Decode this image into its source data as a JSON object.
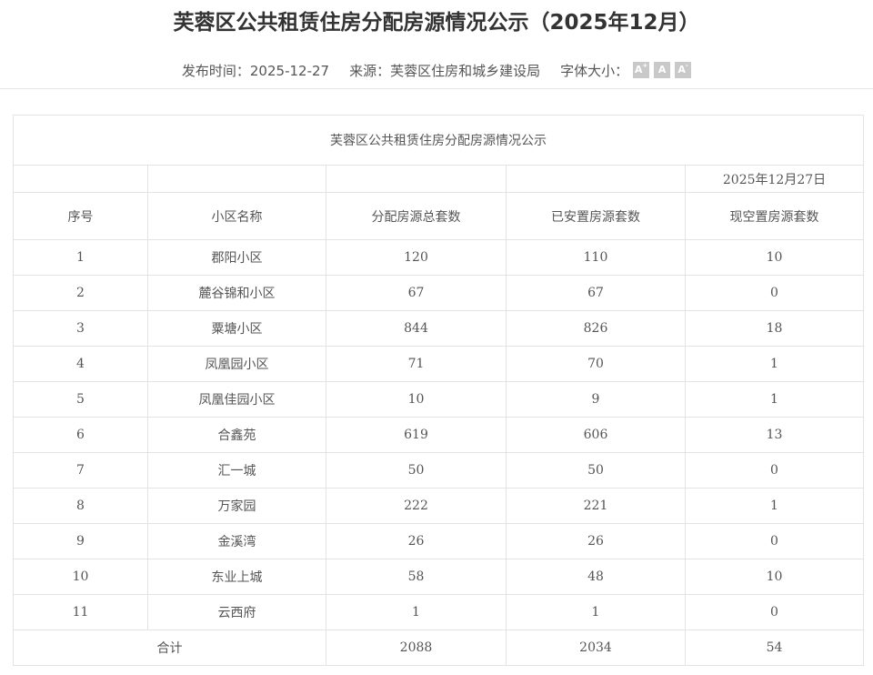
{
  "header": {
    "title": "芙蓉区公共租赁住房分配房源情况公示（2025年12月）",
    "publish_label": "发布时间：2025-12-27",
    "source_label": "来源：芙蓉区住房和城乡建设局",
    "font_size_label": "字体大小：",
    "font_buttons": [
      "A+",
      "A",
      "A-"
    ]
  },
  "table": {
    "caption": "芙蓉区公共租赁住房分配房源情况公示",
    "date": "2025年12月27日",
    "columns": [
      "序号",
      "小区名称",
      "分配房源总套数",
      "已安置房源套数",
      "现空置房源套数"
    ],
    "rows": [
      [
        "1",
        "郡阳小区",
        "120",
        "110",
        "10"
      ],
      [
        "2",
        "麓谷锦和小区",
        "67",
        "67",
        "0"
      ],
      [
        "3",
        "粟塘小区",
        "844",
        "826",
        "18"
      ],
      [
        "4",
        "凤凰园小区",
        "71",
        "70",
        "1"
      ],
      [
        "5",
        "凤凰佳园小区",
        "10",
        "9",
        "1"
      ],
      [
        "6",
        "合鑫苑",
        "619",
        "606",
        "13"
      ],
      [
        "7",
        "汇一城",
        "50",
        "50",
        "0"
      ],
      [
        "8",
        "万家园",
        "222",
        "221",
        "1"
      ],
      [
        "9",
        "金溪湾",
        "26",
        "26",
        "0"
      ],
      [
        "10",
        "东业上城",
        "58",
        "48",
        "10"
      ],
      [
        "11",
        "云西府",
        "1",
        "1",
        "0"
      ]
    ],
    "total": [
      "合计",
      "2088",
      "2034",
      "54"
    ]
  }
}
